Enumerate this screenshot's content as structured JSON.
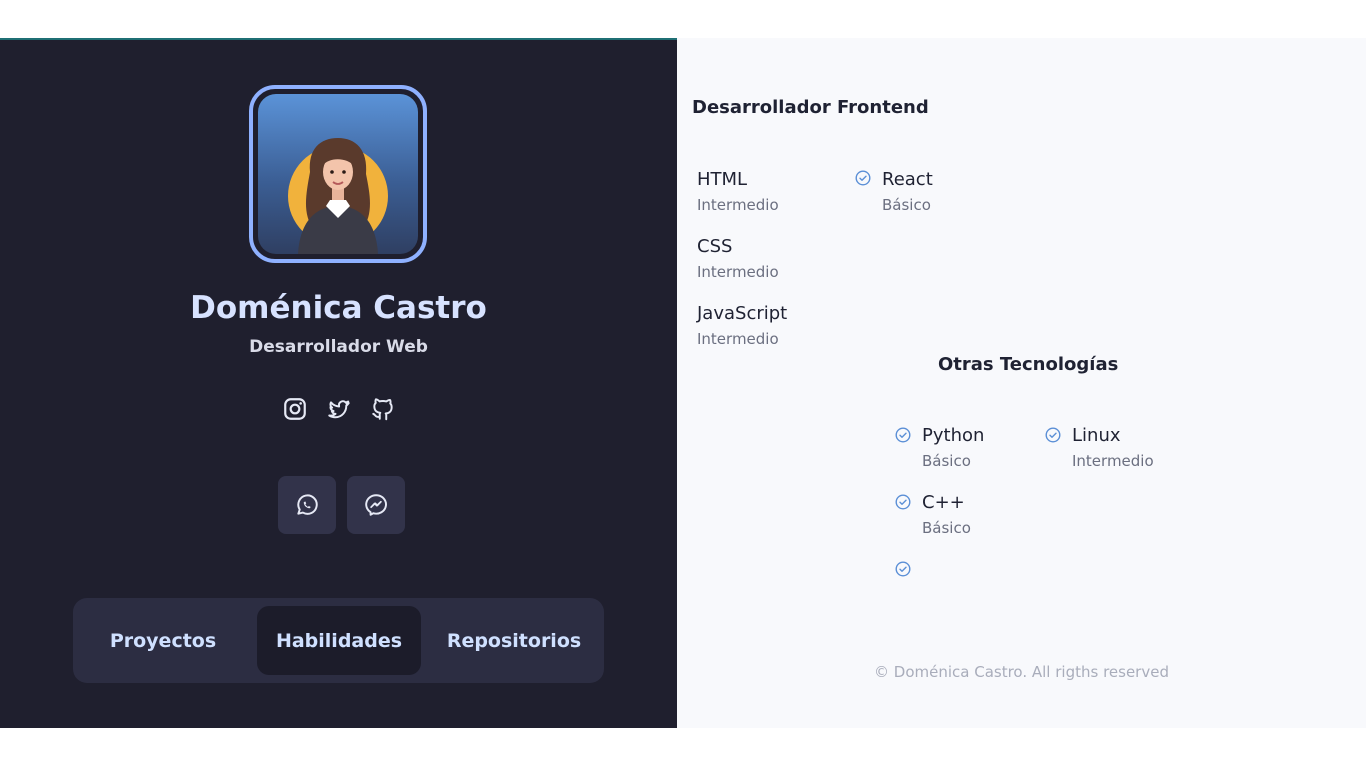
{
  "profile": {
    "name": "Doménica Castro",
    "role": "Desarrollador Web",
    "social": [
      {
        "icon": "instagram-icon"
      },
      {
        "icon": "twitter-icon"
      },
      {
        "icon": "github-icon"
      }
    ],
    "contact": [
      {
        "icon": "whatsapp-icon"
      },
      {
        "icon": "messenger-icon"
      }
    ]
  },
  "tabs": [
    {
      "label": "Proyectos",
      "active": false
    },
    {
      "label": "Habilidades",
      "active": true
    },
    {
      "label": "Repositorios",
      "active": false
    }
  ],
  "frontend": {
    "title": "Desarrollador Frontend",
    "skills": [
      {
        "name": "HTML",
        "level": "Intermedio"
      },
      {
        "name": "CSS",
        "level": "Intermedio"
      },
      {
        "name": "JavaScript",
        "level": "Intermedio"
      },
      {
        "name": "React",
        "level": "Básico"
      }
    ]
  },
  "other": {
    "title": "Otras Tecnologías",
    "skills": [
      {
        "name": "Python",
        "level": "Básico"
      },
      {
        "name": "Linux",
        "level": "Intermedio"
      },
      {
        "name": "C++",
        "level": "Básico"
      }
    ]
  },
  "footer": {
    "text": "© Doménica Castro. All rigths reserved"
  },
  "colors": {
    "panel_dark": "#1f1f2e",
    "accent": "#8fb1ff",
    "check": "#5b8fd6"
  }
}
